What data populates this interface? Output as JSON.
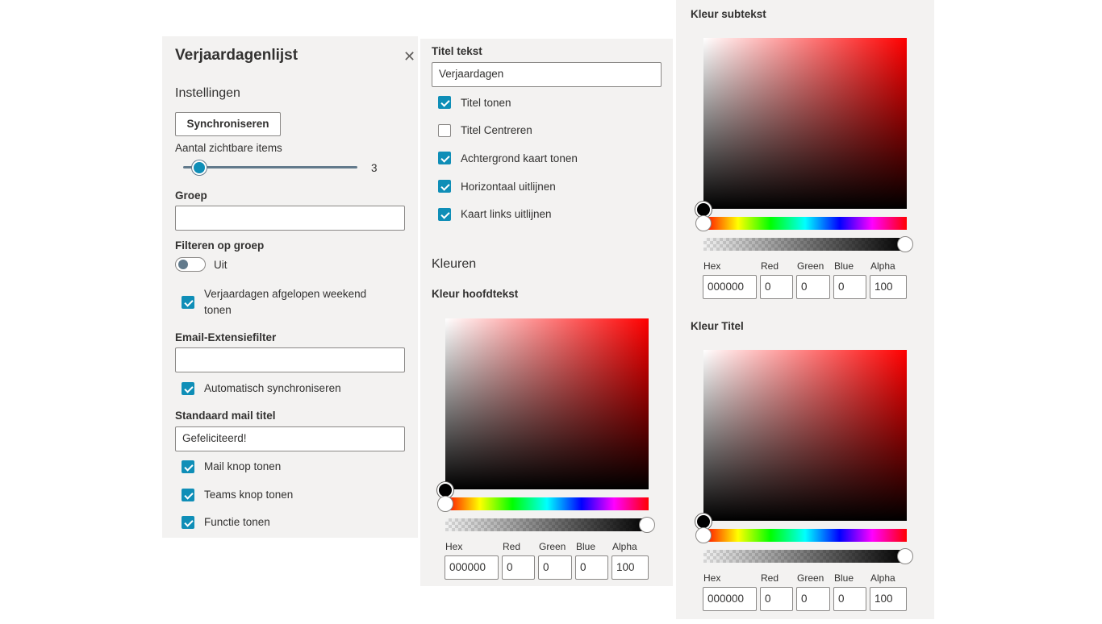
{
  "panel1": {
    "title": "Verjaardagenlijst",
    "section": "Instellingen",
    "sync_button": "Synchroniseren",
    "visible_items": {
      "label": "Aantal zichtbare items",
      "value": "3",
      "fraction": 0.06
    },
    "group": {
      "label": "Groep",
      "value": ""
    },
    "filter_group": {
      "label": "Filteren op groep",
      "state": "Uit",
      "on": false
    },
    "weekend": {
      "label_line1": "Verjaardagen afgelopen weekend",
      "label_line2": "tonen",
      "checked": true
    },
    "email_filter": {
      "label": "Email-Extensiefilter",
      "value": ""
    },
    "auto_sync": {
      "label": "Automatisch synchroniseren",
      "checked": true
    },
    "mail_title": {
      "label": "Standaard mail titel",
      "value": "Gefeliciteerd!"
    },
    "mail_button": {
      "label": "Mail knop tonen",
      "checked": true
    },
    "teams_button": {
      "label": "Teams knop tonen",
      "checked": true
    },
    "function": {
      "label": "Functie tonen",
      "checked": true
    }
  },
  "panel2": {
    "title_text": {
      "label": "Titel tekst",
      "value": "Verjaardagen"
    },
    "checks": [
      {
        "label": "Titel tonen",
        "checked": true
      },
      {
        "label": "Titel Centreren",
        "checked": false
      },
      {
        "label": "Achtergrond kaart tonen",
        "checked": true
      },
      {
        "label": "Horizontaal uitlijnen",
        "checked": true
      },
      {
        "label": "Kaart links uitlijnen",
        "checked": true
      }
    ],
    "colors_heading": "Kleuren",
    "main_text_color": {
      "label": "Kleur hoofdtekst",
      "hex_label": "Hex",
      "red_label": "Red",
      "green_label": "Green",
      "blue_label": "Blue",
      "alpha_label": "Alpha",
      "hex": "000000",
      "red": "0",
      "green": "0",
      "blue": "0",
      "alpha": "100"
    }
  },
  "panel3": {
    "subtext_color": {
      "label": "Kleur subtekst",
      "hex_label": "Hex",
      "red_label": "Red",
      "green_label": "Green",
      "blue_label": "Blue",
      "alpha_label": "Alpha",
      "hex": "000000",
      "red": "0",
      "green": "0",
      "blue": "0",
      "alpha": "100"
    },
    "title_color": {
      "label": "Kleur Titel",
      "hex_label": "Hex",
      "red_label": "Red",
      "green_label": "Green",
      "blue_label": "Blue",
      "alpha_label": "Alpha",
      "hex": "000000",
      "red": "0",
      "green": "0",
      "blue": "0",
      "alpha": "100"
    }
  },
  "colors": {
    "panel_bg": "#f3f2f1",
    "accent": "#0f8eb7",
    "slider_track": "#627a8c",
    "border": "#8a8886"
  },
  "icons": {
    "close": "close-icon",
    "checkmark": "checkmark-icon"
  }
}
